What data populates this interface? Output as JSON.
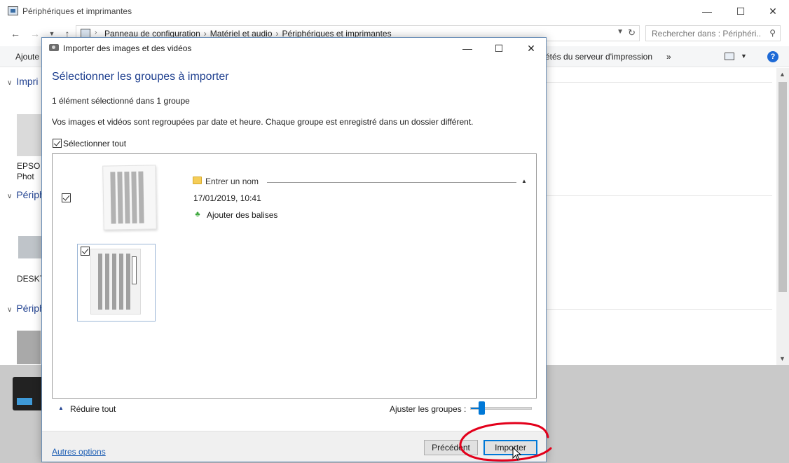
{
  "explorer": {
    "title": "Périphériques et imprimantes",
    "breadcrumbs": [
      "Panneau de configuration",
      "Matériel et audio",
      "Périphériques et imprimantes"
    ],
    "search_placeholder": "Rechercher dans : Périphéri...",
    "commands": {
      "add": "Ajoute",
      "print_server": "étés du serveur d'impression",
      "more": "»"
    },
    "groups": [
      "Impri",
      "Périph",
      "Périph"
    ],
    "devices": [
      "EPSO",
      "Phot",
      "DESKTO"
    ]
  },
  "dialog": {
    "title": "Importer des images et des vidéos",
    "heading": "Sélectionner les groupes à importer",
    "selection_count": "1 élément sélectionné dans 1 groupe",
    "description": "Vos images et vidéos sont regroupées par date et heure. Chaque groupe est enregistré dans un dossier différent.",
    "select_all_label": "Sélectionner tout",
    "select_all_checked": true,
    "group": {
      "name_placeholder": "Entrer un nom",
      "date": "17/01/2019, 10:41",
      "add_tags": "Ajouter des balises",
      "checked": true,
      "item_checked": true
    },
    "collapse_all": "Réduire tout",
    "adjust_groups_label": "Ajuster les groupes :",
    "adjust_groups_level": 0.15,
    "more_options": "Autres options",
    "buttons": {
      "previous": "Précédent",
      "import": "Importer"
    }
  },
  "colors": {
    "heading": "#1e3f8f",
    "link": "#1e5fb4",
    "accent": "#0078d7",
    "annotation": "#e3001b"
  }
}
